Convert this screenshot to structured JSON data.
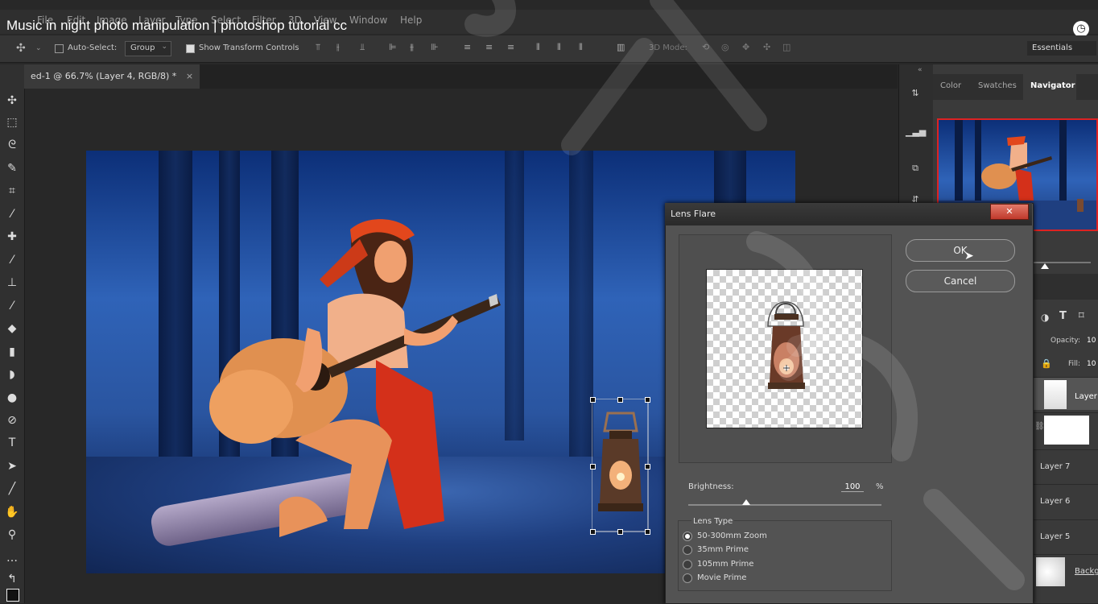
{
  "video_title": "Music in night photo manipulation | photoshop tutorial cc",
  "menu": [
    "File",
    "Edit",
    "Image",
    "Layer",
    "Type",
    "Select",
    "Filter",
    "3D",
    "View",
    "Window",
    "Help"
  ],
  "options_bar": {
    "auto_select_label": "Auto-Select:",
    "auto_select_checked": false,
    "auto_select_value": "Group",
    "show_transform_label": "Show Transform Controls",
    "show_transform_checked": true,
    "mode_3d_label": "3D Mode:",
    "workspace": "Essentials"
  },
  "document_tab": {
    "title": "ed-1 @ 66.7% (Layer 4, RGB/8) *",
    "close": "×"
  },
  "panels": {
    "tabs": [
      "Color",
      "Swatches",
      "Navigator"
    ],
    "active_tab": "Navigator",
    "layer_props": {
      "opacity_label": "Opacity:",
      "opacity_value": "10",
      "fill_label": "Fill:",
      "fill_value": "10"
    },
    "layers": [
      {
        "name": "Layer"
      },
      {
        "name": ""
      },
      {
        "name": "Layer 7"
      },
      {
        "name": "Layer 6"
      },
      {
        "name": "Layer 5"
      },
      {
        "name": "Backg"
      }
    ]
  },
  "dialog": {
    "title": "Lens Flare",
    "close": "✕",
    "ok_label": "OK",
    "cancel_label": "Cancel",
    "brightness_label": "Brightness:",
    "brightness_value": "100",
    "brightness_unit": "%",
    "brightness_level": 0.3,
    "lens_type_label": "Lens Type",
    "lens_types": [
      "50-300mm Zoom",
      "35mm Prime",
      "105mm Prime",
      "Movie Prime"
    ],
    "selected_lens": "50-300mm Zoom"
  },
  "colors": {
    "app_bg": "#282828",
    "dialog_bg": "#535353",
    "close_red": "#c0392b",
    "night_blue": "#2f63b8",
    "dress_red": "#d4301a",
    "guitar": "#e09050"
  }
}
